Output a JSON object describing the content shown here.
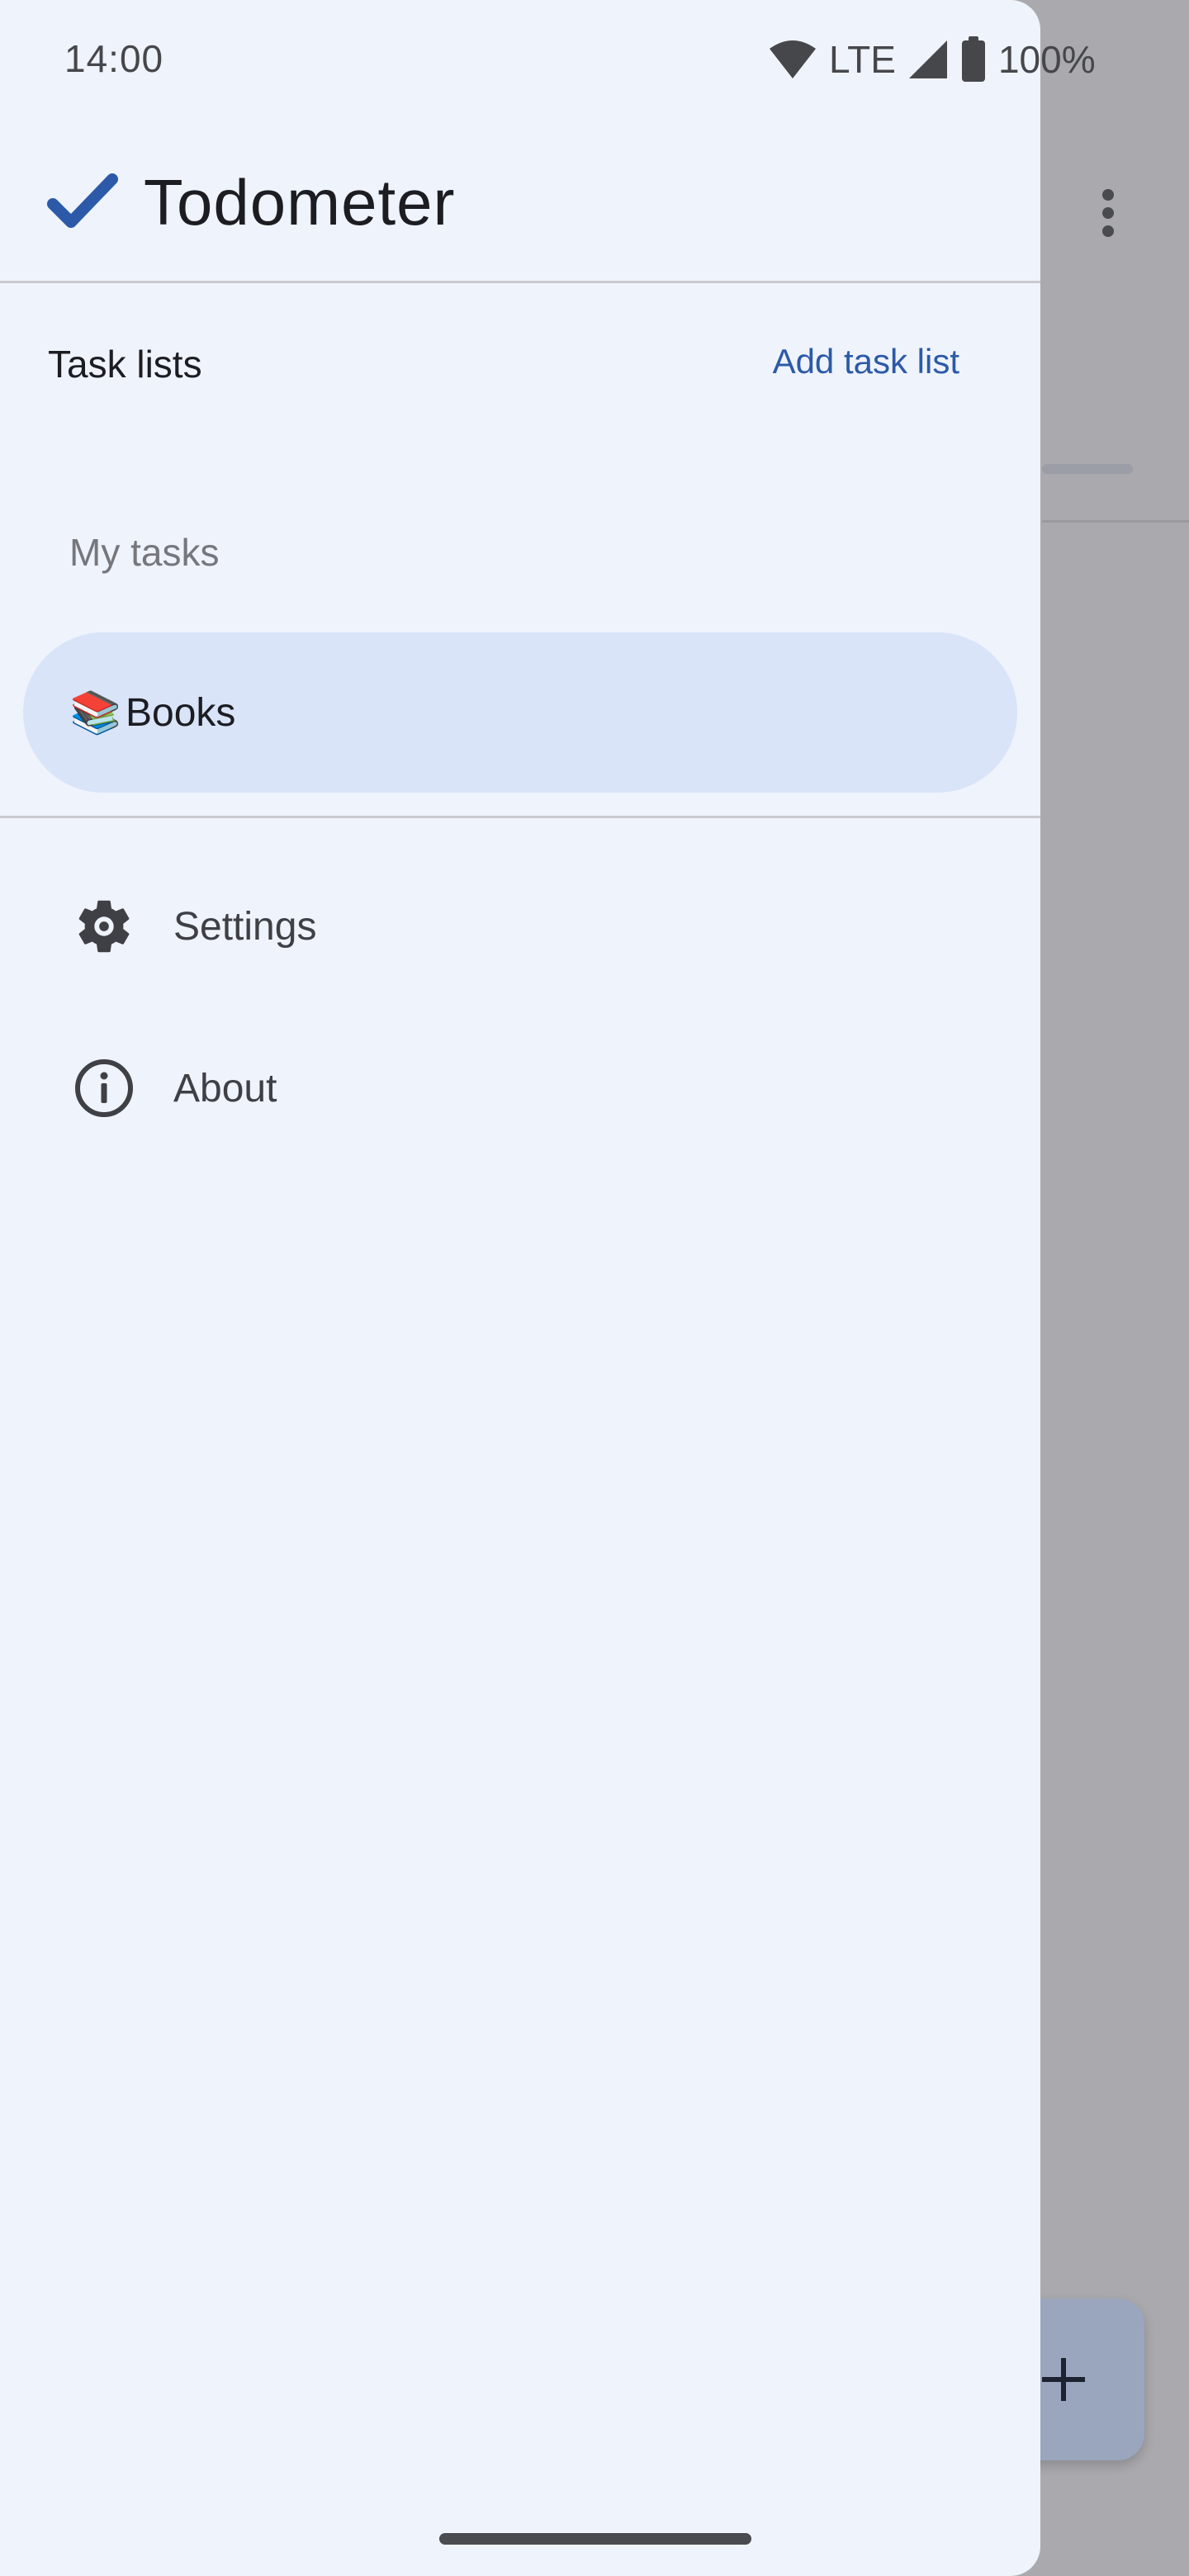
{
  "status_bar": {
    "time": "14:00",
    "network": "LTE",
    "battery": "100%"
  },
  "app": {
    "title": "Todometer",
    "accent_color": "#2c5aa8"
  },
  "drawer": {
    "section_title": "Task lists",
    "add_list_label": "Add task list",
    "group_label": "My tasks",
    "lists": [
      {
        "emoji": "📚",
        "label": "Books",
        "selected": true
      }
    ],
    "menu": [
      {
        "icon": "gear-icon",
        "label": "Settings"
      },
      {
        "icon": "info-icon",
        "label": "About"
      }
    ]
  },
  "background": {
    "fab_icon": "plus-icon",
    "overflow_icon": "more-vert-icon"
  }
}
